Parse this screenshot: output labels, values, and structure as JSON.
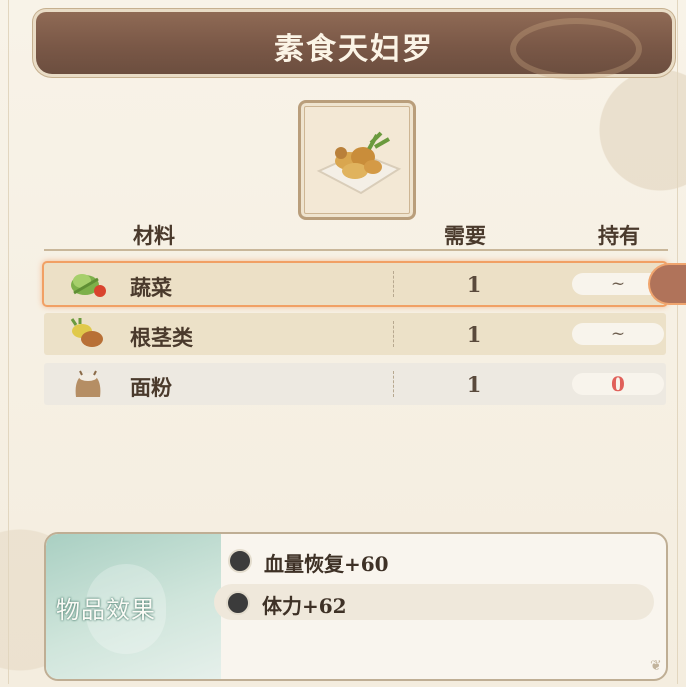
{
  "title": "素食天妇罗",
  "dish_icon": "tempura-dish-icon",
  "columns": {
    "material": "材料",
    "need": "需要",
    "have": "持有"
  },
  "ingredients": [
    {
      "name": "蔬菜",
      "icon": "vegetables-icon",
      "need": "1",
      "have": "~",
      "selected": true
    },
    {
      "name": "根茎类",
      "icon": "root-vegetables-icon",
      "need": "1",
      "have": "~",
      "selected": false
    },
    {
      "name": "面粉",
      "icon": "flour-sack-icon",
      "need": "1",
      "have": "0",
      "selected": false
    }
  ],
  "effects": {
    "label": "物品效果",
    "items": [
      {
        "icon": "health-restore-icon",
        "text": "血量恢复+60"
      },
      {
        "icon": "stamina-bolt-icon",
        "text": "体力+62"
      }
    ]
  },
  "colors": {
    "title_bar": "#7a5847",
    "selected_glow": "#f1a064",
    "zero_count": "#e0605a",
    "effect_panel_accent": "#a9cfc2"
  }
}
